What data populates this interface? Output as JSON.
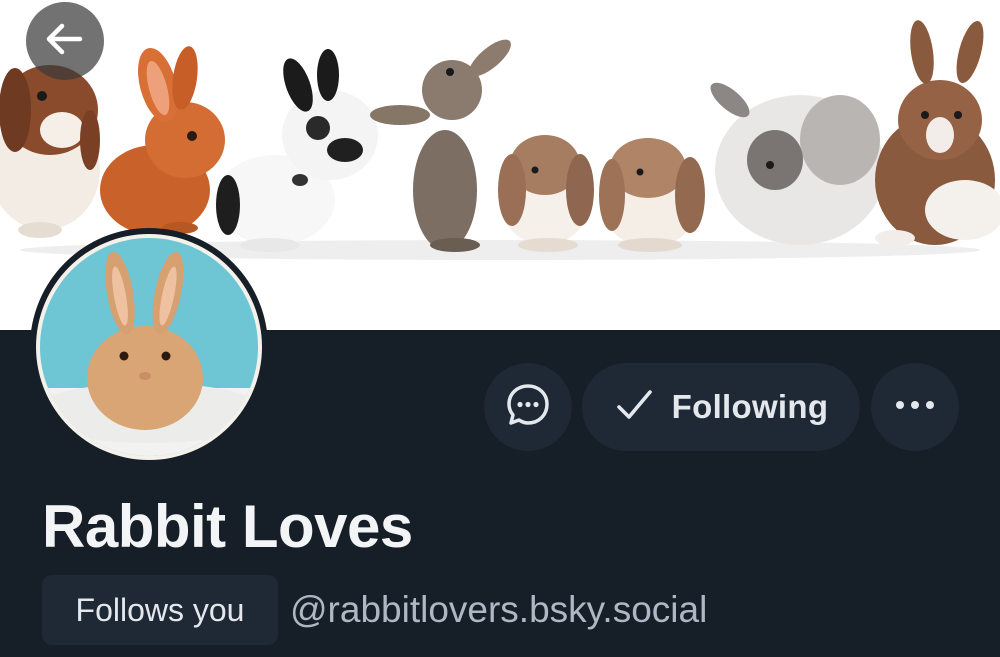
{
  "profile": {
    "display_name": "Rabbit Loves",
    "handle": "@rabbitlovers.bsky.social",
    "follows_you_badge": "Follows you"
  },
  "actions": {
    "follow_label": "Following",
    "message_icon": "chat-bubble-icon",
    "more_icon": "ellipsis-icon",
    "back_icon": "arrow-left-icon"
  },
  "colors": {
    "background": "#161e27",
    "button_bg": "#1e2935",
    "text_primary": "#f2f4f6",
    "text_secondary": "#aeb8c4",
    "banner_bg": "#ffffff"
  }
}
